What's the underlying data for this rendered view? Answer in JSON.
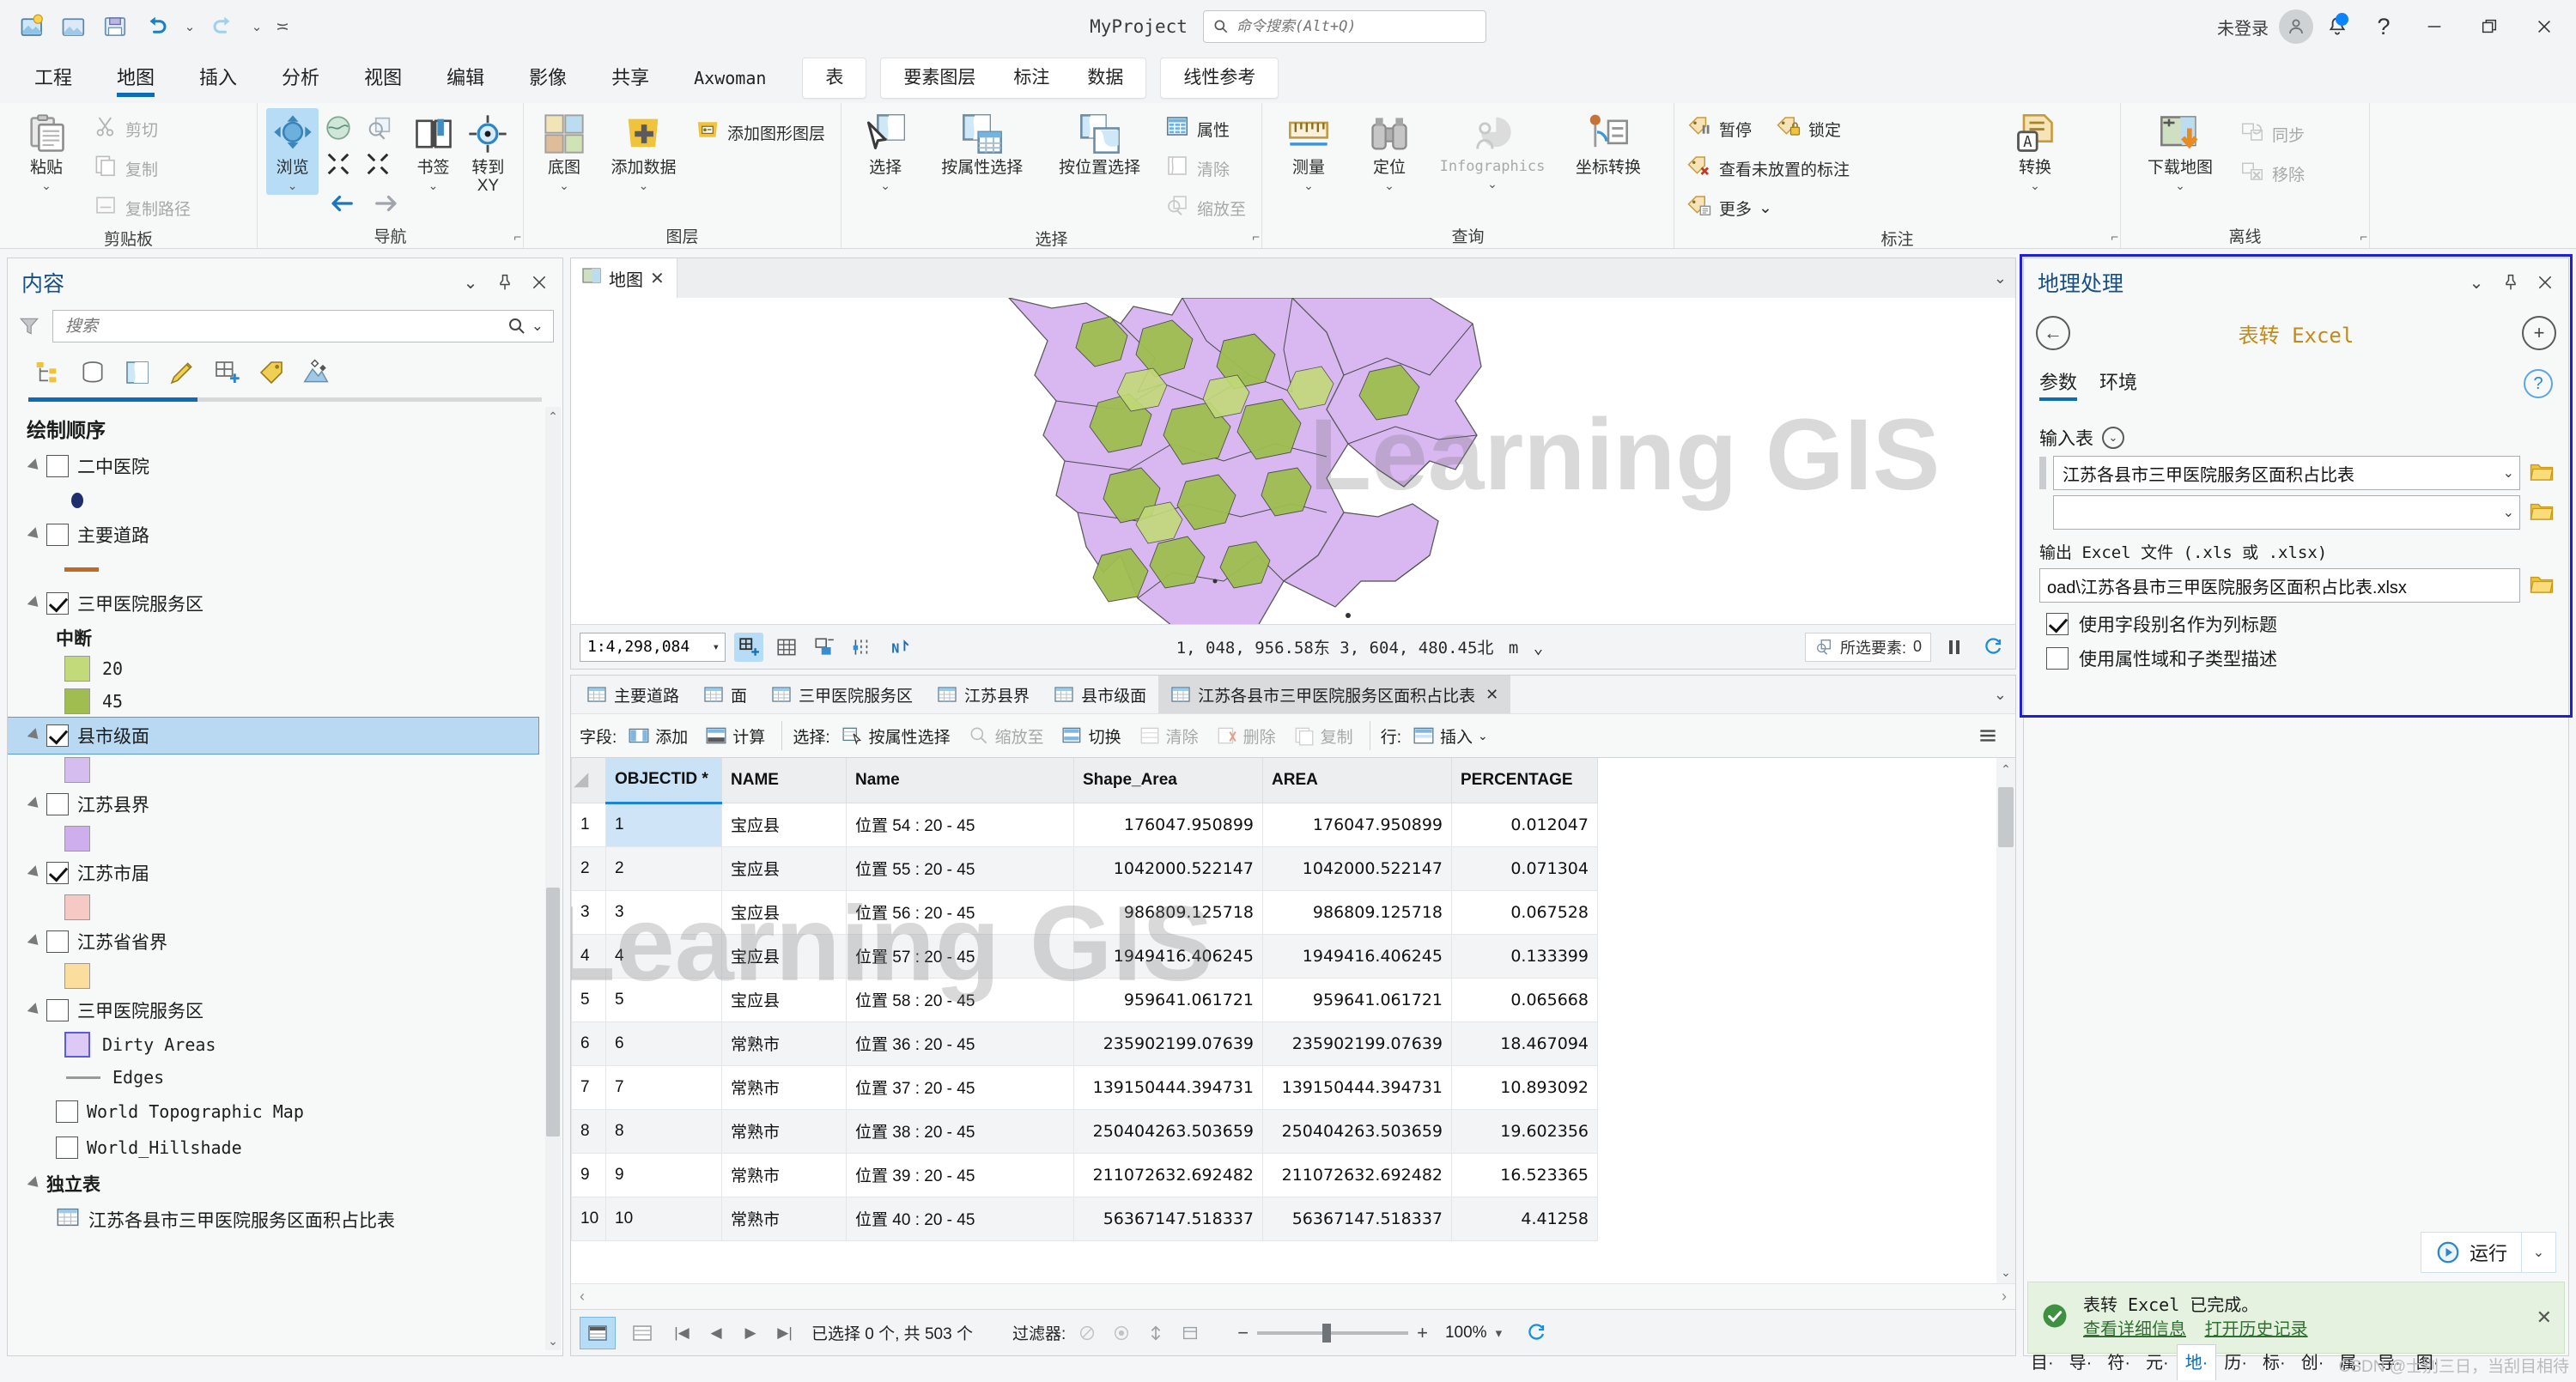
{
  "titlebar": {
    "project_name": "MyProject",
    "search_placeholder": "命令搜索(Alt+Q)",
    "signin_label": "未登录",
    "qat": [
      {
        "name": "new-project-icon"
      },
      {
        "name": "open-project-icon"
      },
      {
        "name": "save-project-icon"
      },
      {
        "name": "undo-icon"
      },
      {
        "name": "redo-icon"
      },
      {
        "name": "customize-qat-icon"
      }
    ]
  },
  "ribbon": {
    "tabs": [
      {
        "label": "工程",
        "active": false
      },
      {
        "label": "地图",
        "active": true
      },
      {
        "label": "插入",
        "active": false
      },
      {
        "label": "分析",
        "active": false
      },
      {
        "label": "视图",
        "active": false
      },
      {
        "label": "编辑",
        "active": false
      },
      {
        "label": "影像",
        "active": false
      },
      {
        "label": "共享",
        "active": false
      },
      {
        "label": "Axwoman",
        "active": false
      }
    ],
    "ctx_table": [
      "表"
    ],
    "ctx_feature": [
      "要素图层",
      "标注",
      "数据"
    ],
    "ctx_linear": [
      "线性参考"
    ],
    "groups": [
      {
        "name": "剪贴板",
        "big": [
          {
            "label": "粘贴",
            "caret": true
          }
        ],
        "small": [
          {
            "label": "剪切",
            "disabled": true
          },
          {
            "label": "复制",
            "disabled": true
          },
          {
            "label": "复制路径",
            "disabled": true
          }
        ]
      },
      {
        "name": "导航",
        "big": [
          {
            "label": "浏览",
            "caret": true,
            "active": true
          },
          {
            "label": "书签",
            "caret": true
          },
          {
            "label": "转到 XY",
            "caret": false
          }
        ]
      },
      {
        "name": "图层",
        "big": [
          {
            "label": "底图",
            "caret": true
          },
          {
            "label": "添加数据",
            "caret": true
          }
        ],
        "small": [
          {
            "label": "添加图形图层",
            "disabled": false
          }
        ]
      },
      {
        "name": "选择",
        "big": [
          {
            "label": "选择",
            "caret": true
          },
          {
            "label": "按属性选择",
            "caret": false
          },
          {
            "label": "按位置选择",
            "caret": false
          }
        ],
        "small": [
          {
            "label": "属性",
            "disabled": false
          },
          {
            "label": "清除",
            "disabled": true
          },
          {
            "label": "缩放至",
            "disabled": true
          }
        ]
      },
      {
        "name": "查询",
        "big": [
          {
            "label": "测量",
            "caret": true
          },
          {
            "label": "定位",
            "caret": true
          },
          {
            "label": "Infographics",
            "caret": true,
            "disabled": true
          },
          {
            "label": "坐标转换",
            "caret": false
          }
        ]
      },
      {
        "name": "标注",
        "small": [
          {
            "label": "暂停",
            "disabled": false
          },
          {
            "label": "锁定",
            "disabled": false
          },
          {
            "label": "查看未放置的标注",
            "disabled": false
          },
          {
            "label": "更多",
            "disabled": false,
            "caret": true
          }
        ],
        "big": [
          {
            "label": "转换",
            "caret": true
          }
        ]
      },
      {
        "name": "离线",
        "big": [
          {
            "label": "下载地图",
            "caret": true
          }
        ],
        "small": [
          {
            "label": "同步",
            "disabled": true
          },
          {
            "label": "移除",
            "disabled": true
          }
        ]
      }
    ]
  },
  "contents": {
    "title": "内容",
    "search_placeholder": "搜索",
    "toolbar_icons": [
      "list-by-drawing-order-icon",
      "list-by-data-source-icon",
      "list-by-selection-icon",
      "list-by-editing-icon",
      "list-by-snapping-icon",
      "list-by-labeling-icon",
      "list-by-diagram-icon"
    ],
    "section_title": "绘制顺序",
    "layers": [
      {
        "label": "二中医院",
        "checked": false,
        "symbols": [
          {
            "type": "point",
            "color": "#1f2f6e"
          }
        ]
      },
      {
        "label": "主要道路",
        "checked": false,
        "symbols": [
          {
            "type": "line",
            "color": "#c06a2a"
          }
        ]
      },
      {
        "label": "三甲医院服务区",
        "checked": true,
        "sub_head": "中断",
        "symbols": [
          {
            "type": "swatch",
            "color": "#c2da79",
            "label": "20"
          },
          {
            "type": "swatch",
            "color": "#9fbe4f",
            "label": "45"
          }
        ]
      },
      {
        "label": "县市级面",
        "checked": true,
        "selected": true,
        "symbols": [
          {
            "type": "swatch",
            "color": "#d6bdf0",
            "label": ""
          }
        ]
      },
      {
        "label": "江苏县界",
        "checked": false,
        "symbols": [
          {
            "type": "swatch",
            "color": "#cfaeee",
            "label": ""
          }
        ]
      },
      {
        "label": "江苏市届",
        "checked": true,
        "symbols": [
          {
            "type": "swatch",
            "color": "#f6c9c4",
            "label": ""
          }
        ]
      },
      {
        "label": "江苏省省界",
        "checked": false,
        "symbols": [
          {
            "type": "swatch",
            "color": "#fade9e",
            "label": ""
          }
        ]
      },
      {
        "label": "三甲医院服务区",
        "checked": false,
        "symbols": [
          {
            "type": "swatch-outline",
            "color": "#dcc9f5",
            "outline": "#5b5bdd",
            "label": "Dirty Areas"
          },
          {
            "type": "line",
            "color": "#9a9a9a",
            "label": "Edges"
          }
        ]
      },
      {
        "label": "World Topographic Map",
        "checked": false,
        "symbols": []
      },
      {
        "label": "World_Hillshade",
        "checked": false,
        "symbols": []
      }
    ],
    "standalone_title": "独立表",
    "standalone_tables": [
      "江苏各县市三甲医院服务区面积占比表"
    ]
  },
  "map": {
    "tab_label": "地图",
    "watermark": "Learning GIS",
    "scale": "1:4,298,084",
    "coordinates": "1, 048, 956.58东  3, 604, 480.45北",
    "coord_unit": "m",
    "selected_label": "所选要素:",
    "selected_count": "0"
  },
  "table": {
    "tabs": [
      {
        "label": "主要道路",
        "active": false
      },
      {
        "label": "面",
        "active": false
      },
      {
        "label": "三甲医院服务区",
        "active": false
      },
      {
        "label": "江苏县界",
        "active": false
      },
      {
        "label": "县市级面",
        "active": false
      },
      {
        "label": "江苏各县市三甲医院服务区面积占比表",
        "active": true
      }
    ],
    "toolbar": {
      "fields_label": "字段:",
      "add_label": "添加",
      "calculate_label": "计算",
      "selection_label": "选择:",
      "select_by_attr_label": "按属性选择",
      "zoom_to_label": "缩放至",
      "switch_label": "切换",
      "clear_label": "清除",
      "delete_label": "删除",
      "copy_label": "复制",
      "rows_label": "行:",
      "insert_label": "插入"
    },
    "columns": [
      "OBJECTID *",
      "NAME",
      "Name",
      "Shape_Area",
      "AREA",
      "PERCENTAGE"
    ],
    "rows": [
      {
        "n": "1",
        "objectid": "1",
        "name": "宝应县",
        "name2": "位置 54 : 20 - 45",
        "shape_area": "176047.950899",
        "area": "176047.950899",
        "percentage": "0.012047"
      },
      {
        "n": "2",
        "objectid": "2",
        "name": "宝应县",
        "name2": "位置 55 : 20 - 45",
        "shape_area": "1042000.522147",
        "area": "1042000.522147",
        "percentage": "0.071304"
      },
      {
        "n": "3",
        "objectid": "3",
        "name": "宝应县",
        "name2": "位置 56 : 20 - 45",
        "shape_area": "986809.125718",
        "area": "986809.125718",
        "percentage": "0.067528"
      },
      {
        "n": "4",
        "objectid": "4",
        "name": "宝应县",
        "name2": "位置 57 : 20 - 45",
        "shape_area": "1949416.406245",
        "area": "1949416.406245",
        "percentage": "0.133399"
      },
      {
        "n": "5",
        "objectid": "5",
        "name": "宝应县",
        "name2": "位置 58 : 20 - 45",
        "shape_area": "959641.061721",
        "area": "959641.061721",
        "percentage": "0.065668"
      },
      {
        "n": "6",
        "objectid": "6",
        "name": "常熟市",
        "name2": "位置 36 : 20 - 45",
        "shape_area": "235902199.07639",
        "area": "235902199.07639",
        "percentage": "18.467094"
      },
      {
        "n": "7",
        "objectid": "7",
        "name": "常熟市",
        "name2": "位置 37 : 20 - 45",
        "shape_area": "139150444.394731",
        "area": "139150444.394731",
        "percentage": "10.893092"
      },
      {
        "n": "8",
        "objectid": "8",
        "name": "常熟市",
        "name2": "位置 38 : 20 - 45",
        "shape_area": "250404263.503659",
        "area": "250404263.503659",
        "percentage": "19.602356"
      },
      {
        "n": "9",
        "objectid": "9",
        "name": "常熟市",
        "name2": "位置 39 : 20 - 45",
        "shape_area": "211072632.692482",
        "area": "211072632.692482",
        "percentage": "16.523365"
      },
      {
        "n": "10",
        "objectid": "10",
        "name": "常熟市",
        "name2": "位置 40 : 20 - 45",
        "shape_area": "56367147.518337",
        "area": "56367147.518337",
        "percentage": "4.41258"
      }
    ],
    "status": {
      "selected_text": "已选择 0 个, 共 503 个",
      "filter_label": "过滤器:",
      "zoom_percent": "100%"
    }
  },
  "geoprocessing": {
    "title": "地理处理",
    "tool_name": "表转 Excel",
    "tabs": [
      {
        "label": "参数",
        "active": true
      },
      {
        "label": "环境",
        "active": false
      }
    ],
    "input_table_label": "输入表",
    "input_table_value": "江苏各县市三甲医院服务区面积占比表",
    "input_table_value2": "",
    "output_label": "输出 Excel 文件 (.xls 或 .xlsx)",
    "output_value": "oad\\江苏各县市三甲医院服务区面积占比表.xlsx",
    "checkbox1_label": "使用字段别名作为列标题",
    "checkbox1_checked": true,
    "checkbox2_label": "使用属性域和子类型描述",
    "checkbox2_checked": false,
    "run_label": "运行",
    "toast": {
      "message": "表转 Excel 已完成。",
      "link1": "查看详细信息",
      "link2": "打开历史记录"
    }
  },
  "dock": {
    "tabs": [
      {
        "label": "目·",
        "active": false
      },
      {
        "label": "导·",
        "active": false
      },
      {
        "label": "符·",
        "active": false
      },
      {
        "label": "元·",
        "active": false
      },
      {
        "label": "地·",
        "active": true
      },
      {
        "label": "历·",
        "active": false
      },
      {
        "label": "标·",
        "active": false
      },
      {
        "label": "创·",
        "active": false
      },
      {
        "label": "属·",
        "active": false
      },
      {
        "label": "导·",
        "active": false
      },
      {
        "label": "图·",
        "active": false
      }
    ],
    "watermark": "CSDN @士别三日，当刮目相待"
  }
}
